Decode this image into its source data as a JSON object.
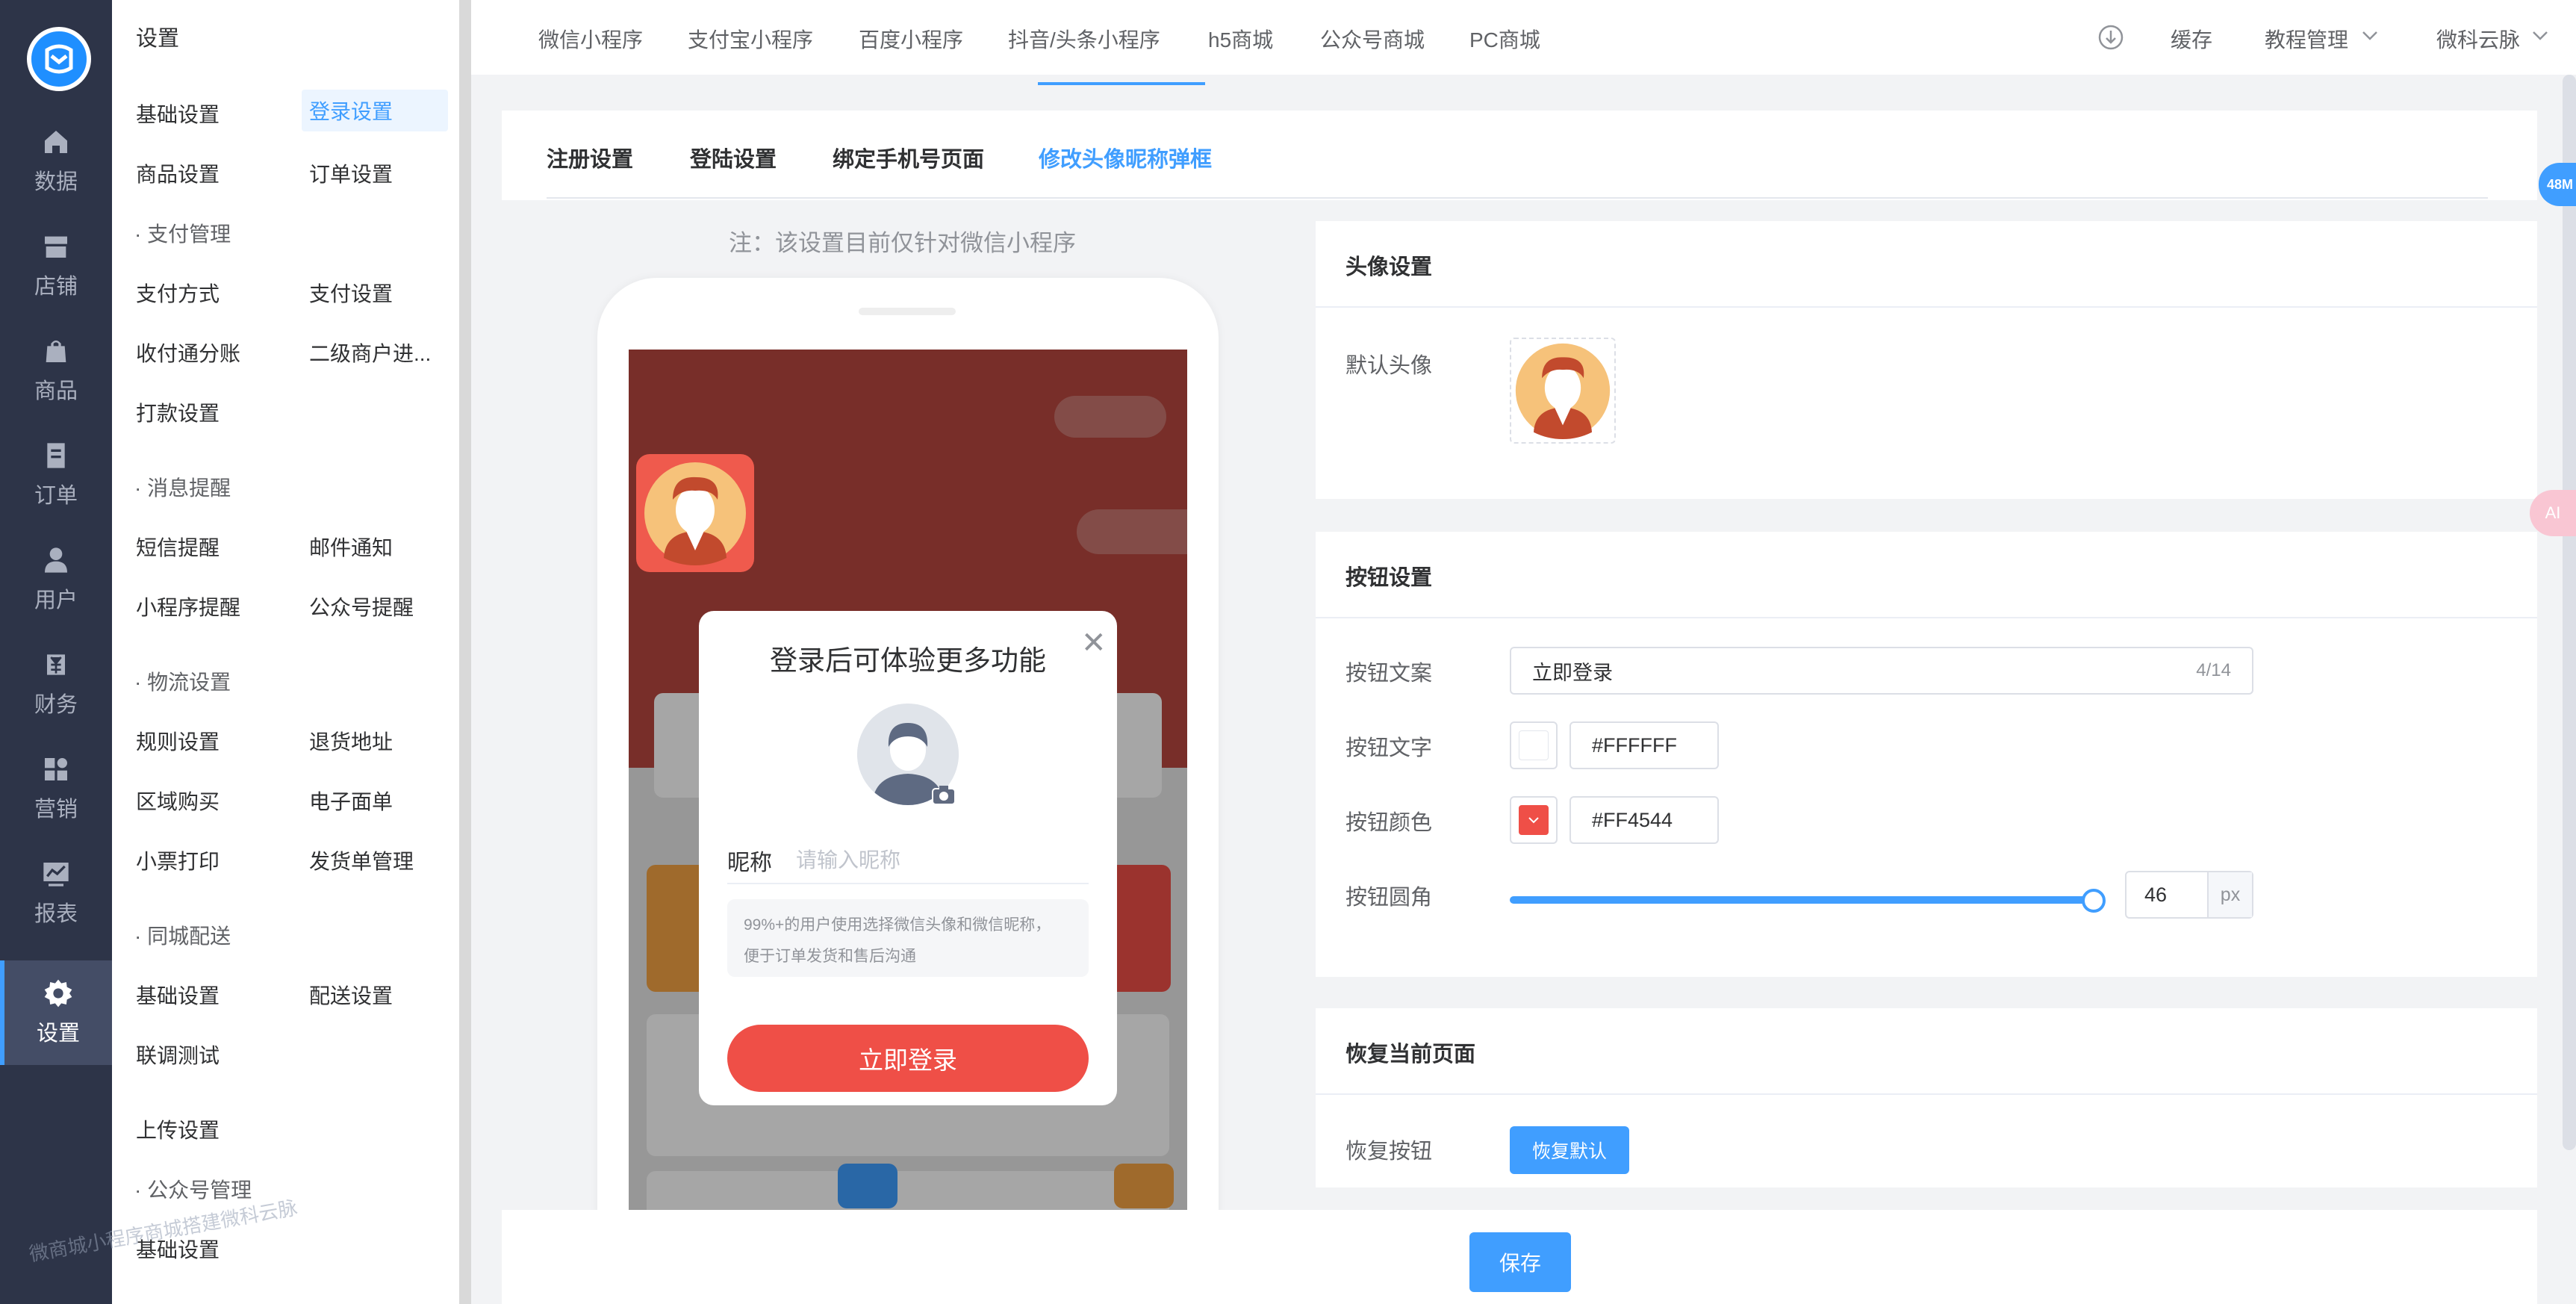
{
  "rail": {
    "items": [
      {
        "label": "数据",
        "icon": "home-icon"
      },
      {
        "label": "店铺",
        "icon": "shop-icon"
      },
      {
        "label": "商品",
        "icon": "bag-icon"
      },
      {
        "label": "订单",
        "icon": "order-icon"
      },
      {
        "label": "用户",
        "icon": "user-icon"
      },
      {
        "label": "财务",
        "icon": "finance-icon"
      },
      {
        "label": "营销",
        "icon": "grid-icon"
      },
      {
        "label": "报表",
        "icon": "chart-icon"
      },
      {
        "label": "设置",
        "icon": "gear-icon"
      }
    ]
  },
  "submenu": {
    "title": "设置",
    "items": {
      "basic": "基础设置",
      "login": "登录设置",
      "goods": "商品设置",
      "order": "订单设置",
      "pay_group": "· 支付管理",
      "pay_method": "支付方式",
      "pay_setting": "支付设置",
      "split": "收付通分账",
      "sub_merchant": "二级商户进...",
      "payout": "打款设置",
      "msg_group": "· 消息提醒",
      "sms": "短信提醒",
      "mail": "邮件通知",
      "mini_remind": "小程序提醒",
      "mp_remind": "公众号提醒",
      "logistics_group": "· 物流设置",
      "rule": "规则设置",
      "return_addr": "退货地址",
      "region_buy": "区域购买",
      "e_waybill": "电子面单",
      "receipt": "小票打印",
      "ship_manage": "发货单管理",
      "city_group": "· 同城配送",
      "city_basic": "基础设置",
      "delivery": "配送设置",
      "joint_test": "联调测试",
      "upload": "上传设置",
      "mp_group": "· 公众号管理",
      "mp_basic": "基础设置"
    }
  },
  "topnav": {
    "links": [
      "微信小程序",
      "支付宝小程序",
      "百度小程序",
      "抖音/头条小程序",
      "h5商城",
      "公众号商城",
      "PC商城"
    ],
    "cache": "缓存",
    "tutorial": "教程管理",
    "account": "微科云脉"
  },
  "tabs": [
    "注册设置",
    "登陆设置",
    "绑定手机号页面",
    "修改头像昵称弹框"
  ],
  "preview": {
    "note": "注：该设置目前仅针对微信小程序",
    "modal_title": "登录后可体验更多功能",
    "nickname_label": "昵称",
    "nickname_placeholder": "请输入昵称",
    "hint_line1": "99%+的用户使用选择微信头像和微信昵称，",
    "hint_line2": "便于订单发货和售后沟通",
    "login_button": "立即登录"
  },
  "avatar_card": {
    "title": "头像设置",
    "default_label": "默认头像"
  },
  "button_card": {
    "title": "按钮设置",
    "text_label": "按钮文案",
    "text_value": "立即登录",
    "text_count": "4/14",
    "font_color_label": "按钮文字",
    "font_color": "#FFFFFF",
    "bg_color_label": "按钮颜色",
    "bg_color": "#FF4544",
    "radius_label": "按钮圆角",
    "radius_value": "46",
    "radius_unit": "px",
    "radius_fill": 1.0
  },
  "restore_card": {
    "title": "恢复当前页面",
    "label": "恢复按钮",
    "button": "恢复默认"
  },
  "save_button": "保存",
  "badges": {
    "memory": "48M",
    "ai": "AI"
  },
  "watermark": "微商城小程序商城搭建微科云脉",
  "colors": {
    "accent": "#409eff",
    "login_red": "#ef4f47"
  }
}
